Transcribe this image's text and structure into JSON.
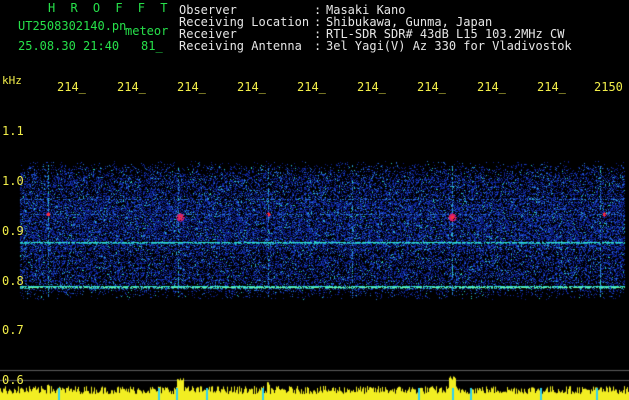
{
  "header": {
    "app_title": "H R O F F T",
    "filename": "UT2508302140.pn",
    "meteor_label": "meteor",
    "timestamp": "25.08.30 21:40",
    "count": "81_"
  },
  "info": {
    "labels": [
      "Observer",
      "Receiving Location",
      "Receiver",
      "Receiving Antenna"
    ],
    "separator": ":",
    "values": [
      "Masaki Kano",
      "Shibukawa, Gunma, Japan",
      "RTL-SDR SDR# 43dB L15 103.2MHz CW",
      "3el Yagi(V) Az 330 for Vladivostok"
    ]
  },
  "axes": {
    "y_unit": "kHz",
    "y_ticks": [
      "1.1",
      "1.0",
      "0.9",
      "0.8",
      "0.7",
      "0.6"
    ],
    "x_ticks": [
      "214_",
      "214_",
      "214_",
      "214_",
      "214_",
      "214_",
      "214_",
      "214_",
      "214_",
      "2150"
    ]
  },
  "colors": {
    "title": "#26e04a",
    "info": "#e6e6e6",
    "ticks": "#f2ee4a",
    "noise": "#1a3fc8",
    "signal": "#2fe0d0",
    "echo": "#ff2a3a",
    "level": "#f2ee22"
  }
}
